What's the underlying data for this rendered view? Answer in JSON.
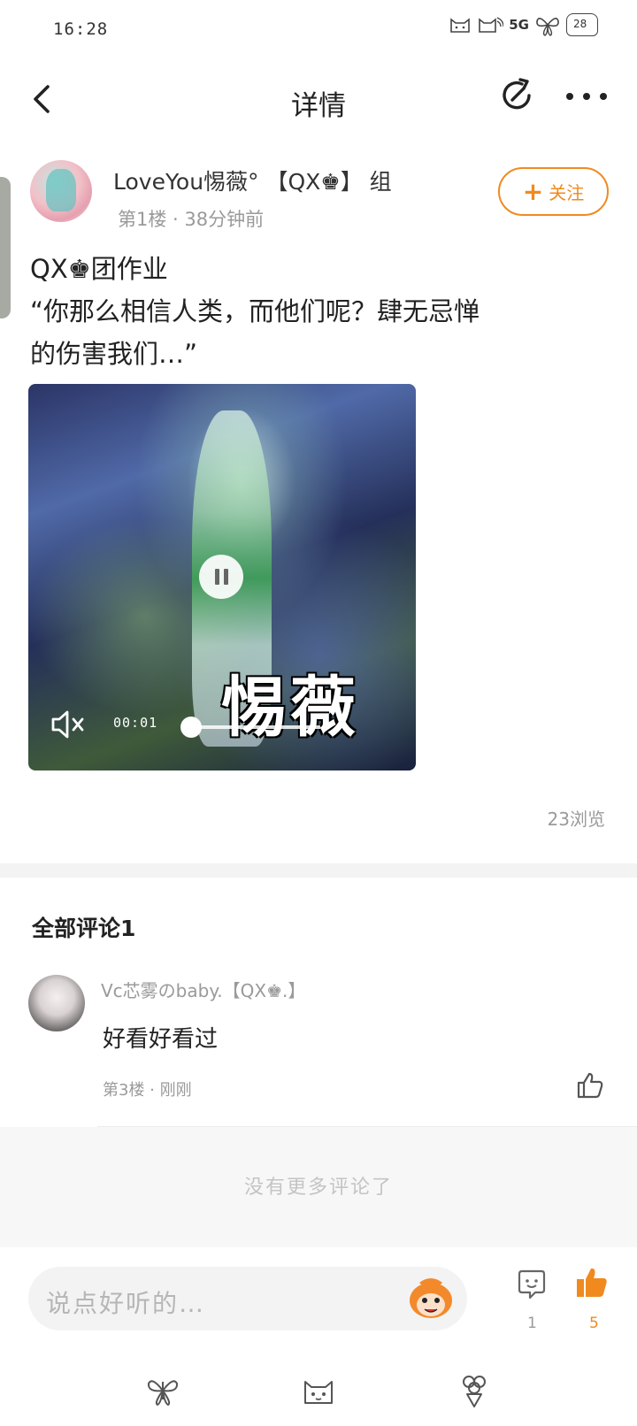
{
  "status_bar": {
    "time": "16:28",
    "network": "5G",
    "battery": "28"
  },
  "header": {
    "title": "详情",
    "back_icon": "chevron-left-icon",
    "share_icon": "share-refresh-icon",
    "more_icon": "more-dots-icon"
  },
  "post": {
    "author": {
      "name": "LoveYou惕薇° 【QX♚】 组",
      "meta": "第1楼 · 38分钟前"
    },
    "follow_label": "关注",
    "text_lines": [
      "QX♚团作业",
      "“你那么相信人类，而他们呢？肆无忌惮",
      "的伤害我们…”"
    ],
    "video": {
      "current_time": "00:01",
      "watermark": "惕薇",
      "progress": 0.05
    },
    "views": "23浏览"
  },
  "comments": {
    "heading": "全部评论1",
    "items": [
      {
        "user": "Vc芯雾のbaby.【QX♚.】",
        "text": "好看好看过",
        "meta": "第3楼 · 刚刚"
      }
    ],
    "no_more": "没有更多评论了"
  },
  "bottom_bar": {
    "placeholder": "说点好听的…",
    "comment_count": "1",
    "like_count": "5"
  },
  "nav_bar": {
    "icons": [
      "butterfly-icon",
      "cat-face-icon",
      "flower-bouquet-icon"
    ]
  },
  "colors": {
    "accent": "#f08a1f",
    "text": "#222222",
    "muted": "#9a9a9a"
  }
}
